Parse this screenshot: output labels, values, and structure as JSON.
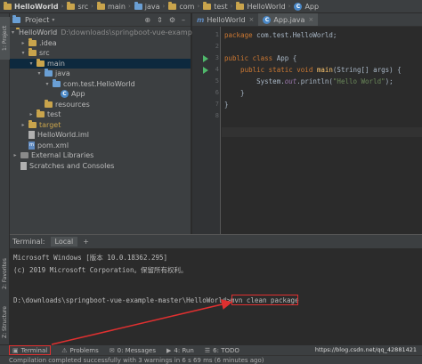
{
  "breadcrumb": [
    "HelloWorld",
    "src",
    "main",
    "java",
    "com",
    "test",
    "HelloWorld",
    "App"
  ],
  "left_stripe": {
    "project": "1: Project",
    "favorites": "2: Favorites",
    "structure": "Z: Structure"
  },
  "project_panel": {
    "title": "Project",
    "tree": [
      {
        "label": "HelloWorld",
        "note": "D:\\downloads\\springboot-vue-example-mas",
        "icon": "folder-icon",
        "depth": 0,
        "arrow": "▾"
      },
      {
        "label": ".idea",
        "icon": "folder-icon",
        "depth": 1,
        "arrow": "▸"
      },
      {
        "label": "src",
        "icon": "folder-icon",
        "depth": 1,
        "arrow": "▾"
      },
      {
        "label": "main",
        "icon": "folder-icon",
        "depth": 2,
        "arrow": "▾",
        "selected": true
      },
      {
        "label": "java",
        "icon": "source-folder-icon",
        "depth": 3,
        "arrow": "▾"
      },
      {
        "label": "com.test.HelloWorld",
        "icon": "package-icon",
        "depth": 4,
        "arrow": "▾"
      },
      {
        "label": "App",
        "icon": "class-icon",
        "depth": 5,
        "arrow": ""
      },
      {
        "label": "resources",
        "icon": "folder-icon",
        "depth": 3,
        "arrow": ""
      },
      {
        "label": "test",
        "icon": "folder-icon",
        "depth": 2,
        "arrow": "▸"
      },
      {
        "label": "target",
        "icon": "folder-icon",
        "depth": 1,
        "arrow": "▸",
        "gold": true
      },
      {
        "label": "HelloWorld.iml",
        "icon": "file-icon",
        "depth": 1,
        "arrow": ""
      },
      {
        "label": "pom.xml",
        "icon": "maven-file-icon",
        "depth": 1,
        "arrow": ""
      },
      {
        "label": "External Libraries",
        "icon": "library-icon",
        "depth": 0,
        "arrow": "▸"
      },
      {
        "label": "Scratches and Consoles",
        "icon": "scratch-icon",
        "depth": 0,
        "arrow": ""
      }
    ]
  },
  "editor": {
    "tabs": [
      {
        "label": "HelloWorld",
        "icon": "maven-icon",
        "active": false
      },
      {
        "label": "App.java",
        "icon": "class-icon",
        "active": true
      }
    ],
    "line_numbers": [
      "1",
      "2",
      "3",
      "4",
      "5",
      "6",
      "7",
      "8"
    ],
    "lines": {
      "l1_kw": "package",
      "l1_rest": " com.test.HelloWorld;",
      "l3_kw": "public class",
      "l3_rest": " App {",
      "l4_kw": "    public static void",
      "l4_fn": " main",
      "l4_rest": "(String[] args) {",
      "l5_a": "        System.",
      "l5_it": "out",
      "l5_b": ".println(",
      "l5_str": "\"Hello World\"",
      "l5_c": ");",
      "l6": "    }",
      "l7": "}"
    }
  },
  "terminal": {
    "label": "Terminal:",
    "tab": "Local",
    "add": "+",
    "lines": [
      "Microsoft Windows [版本 10.0.18362.295]",
      "(c) 2019 Microsoft Corporation。保留所有权利。",
      "D:\\downloads\\springboot-vue-example-master\\HelloWorld>mvn clean package"
    ]
  },
  "tool_tabs": [
    {
      "label": "Terminal",
      "glyph": "▣"
    },
    {
      "label": "Problems",
      "glyph": "⚠"
    },
    {
      "label": "0: Messages",
      "glyph": "✉"
    },
    {
      "label": "4: Run",
      "glyph": "▶"
    },
    {
      "label": "6: TODO",
      "glyph": "☰"
    }
  ],
  "status": "Compilation completed successfully with 3 warnings in 6 s 69 ms (6 minutes ago)",
  "watermark": "https://blog.csdn.net/qq_42881421",
  "colors": {
    "highlight": "#e03030",
    "keyword": "#cc7832",
    "string": "#6a8759"
  }
}
